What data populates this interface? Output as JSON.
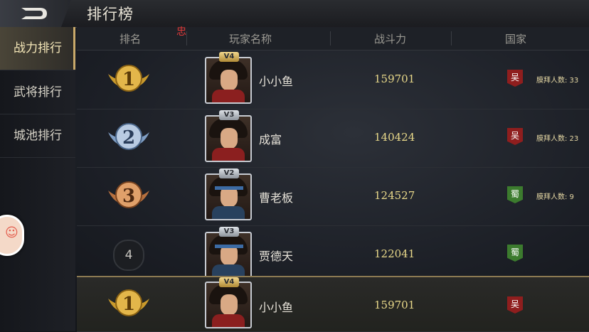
{
  "header": {
    "title": "排行榜",
    "back_icon": "back-arrow-icon"
  },
  "sidebar": {
    "items": [
      {
        "label": "战力排行",
        "active": true
      },
      {
        "label": "武将排行",
        "active": false
      },
      {
        "label": "城池排行",
        "active": false
      }
    ]
  },
  "columns": {
    "rank": "排名",
    "player": "玩家名称",
    "power": "战斗力",
    "nation": "国家",
    "loyal_mark": "忠"
  },
  "colors": {
    "gold": "#e9d98a",
    "nation_wu": "#8f1e1e",
    "nation_shu": "#3c7b2e"
  },
  "rows": [
    {
      "rank": "1",
      "vip": "V4",
      "name": "小小鱼",
      "power": "159701",
      "nation": "吴",
      "worship": "膜拜人数: 33"
    },
    {
      "rank": "2",
      "vip": "V3",
      "name": "成富",
      "power": "140424",
      "nation": "吴",
      "worship": "膜拜人数: 23"
    },
    {
      "rank": "3",
      "vip": "V2",
      "name": "曹老板",
      "power": "124527",
      "nation": "蜀",
      "worship": "膜拜人数: 9"
    },
    {
      "rank": "4",
      "vip": "V3",
      "name": "贾德天",
      "power": "122041",
      "nation": "蜀",
      "worship": ""
    }
  ],
  "my_row": {
    "rank": "1",
    "vip": "V4",
    "name": "小小鱼",
    "power": "159701",
    "nation": "吴"
  }
}
